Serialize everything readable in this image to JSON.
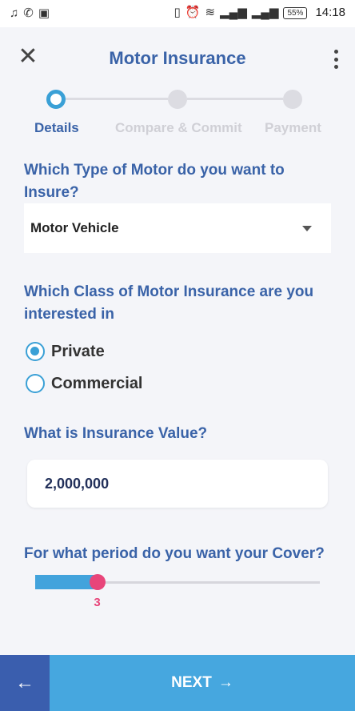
{
  "status_bar": {
    "left_icons": [
      "music-icon",
      "whatsapp-icon",
      "gallery-icon"
    ],
    "right_icons": [
      "vibrate-icon",
      "alarm-icon",
      "wifi-icon",
      "signal-icon",
      "signal-icon"
    ],
    "battery": "55%",
    "time": "14:18"
  },
  "header": {
    "title": "Motor Insurance",
    "close_icon": "close-icon",
    "menu_icon": "more-vertical-icon"
  },
  "stepper": {
    "steps": [
      {
        "label": "Details",
        "active": true
      },
      {
        "label": "Compare & Commit",
        "active": false
      },
      {
        "label": "Payment",
        "active": false
      }
    ]
  },
  "form": {
    "motor_type": {
      "question": "Which Type of Motor do you want to Insure?",
      "value": "Motor Vehicle"
    },
    "insurance_class": {
      "question": "Which Class of Motor Insurance are you interested in",
      "options": [
        {
          "label": "Private",
          "selected": true
        },
        {
          "label": "Commercial",
          "selected": false
        }
      ]
    },
    "insurance_value": {
      "question": "What is Insurance Value?",
      "value": "2,000,000"
    },
    "cover_period": {
      "question": "For what period do you want your Cover?",
      "value": "3",
      "fraction": 0.22
    }
  },
  "footer": {
    "back_icon": "arrow-left-icon",
    "next_label": "NEXT",
    "next_icon": "arrow-right-icon"
  },
  "colors": {
    "primary": "#3a63a8",
    "accent": "#3aa0d6",
    "slider_thumb": "#e8457a",
    "next_button": "#46a7df",
    "back_button": "#3a5eae"
  }
}
